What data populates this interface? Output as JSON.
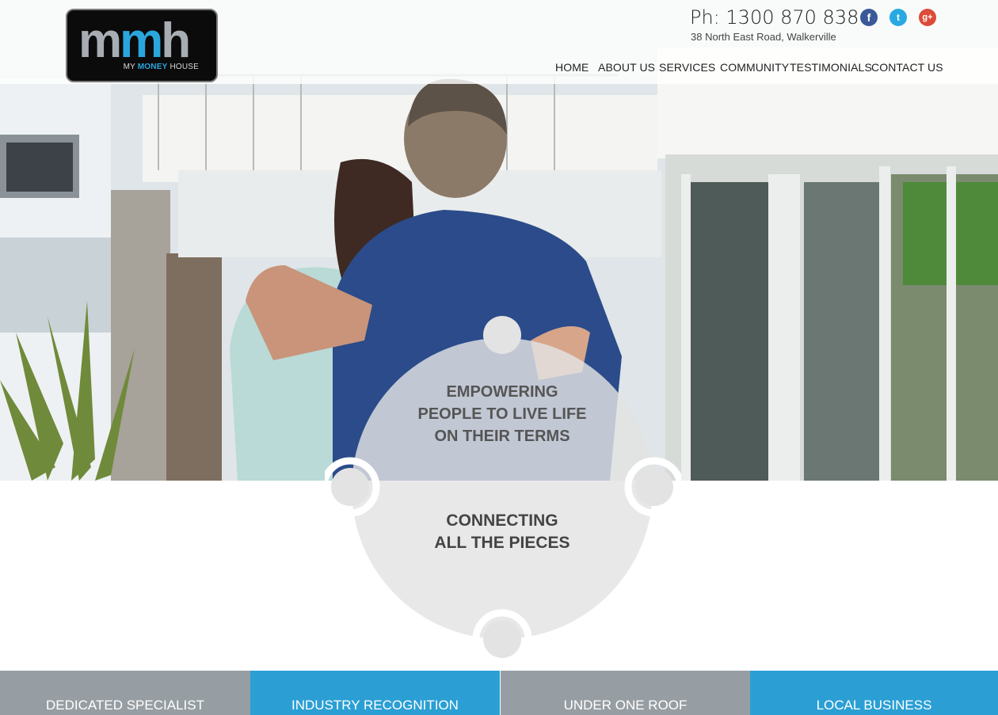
{
  "brand": {
    "logo_text": "mmh",
    "logo_tagline_prefix": "MY",
    "logo_tagline_money": "MONEY",
    "logo_tagline_suffix": "HOUSE"
  },
  "contact": {
    "phone": "Ph: 1300 870 838",
    "address": "38 North East Road, Walkerville"
  },
  "social": [
    {
      "name": "facebook",
      "glyph": "f",
      "color": "#3b5998"
    },
    {
      "name": "twitter",
      "glyph": "t",
      "color": "#29a9e1"
    },
    {
      "name": "google-plus",
      "glyph": "g+",
      "color": "#dd4b39"
    }
  ],
  "nav": [
    "HOME",
    "ABOUT US",
    "SERVICES",
    "COMMUNITY",
    "TESTIMONIALS",
    "CONTACT US"
  ],
  "hero": {
    "tagline_line1": "EMPOWERING",
    "tagline_line2": "PEOPLE TO LIVE LIFE",
    "tagline_line3": "ON THEIR TERMS",
    "sub_line1": "CONNECTING",
    "sub_line2": "ALL THE PIECES"
  },
  "tiles": [
    {
      "label": "DEDICATED SPECIALIST",
      "color": "#979ea3"
    },
    {
      "label": "INDUSTRY RECOGNITION",
      "color": "#2b9fd4"
    },
    {
      "label": "UNDER ONE ROOF",
      "color": "#979ea3"
    },
    {
      "label": "LOCAL BUSINESS",
      "color": "#2b9fd4"
    }
  ],
  "colors": {
    "accent_blue": "#2aa6dd",
    "tile_grey": "#979ea3",
    "tile_blue": "#2b9fd4",
    "circle_grey": "#e3e3e3"
  }
}
